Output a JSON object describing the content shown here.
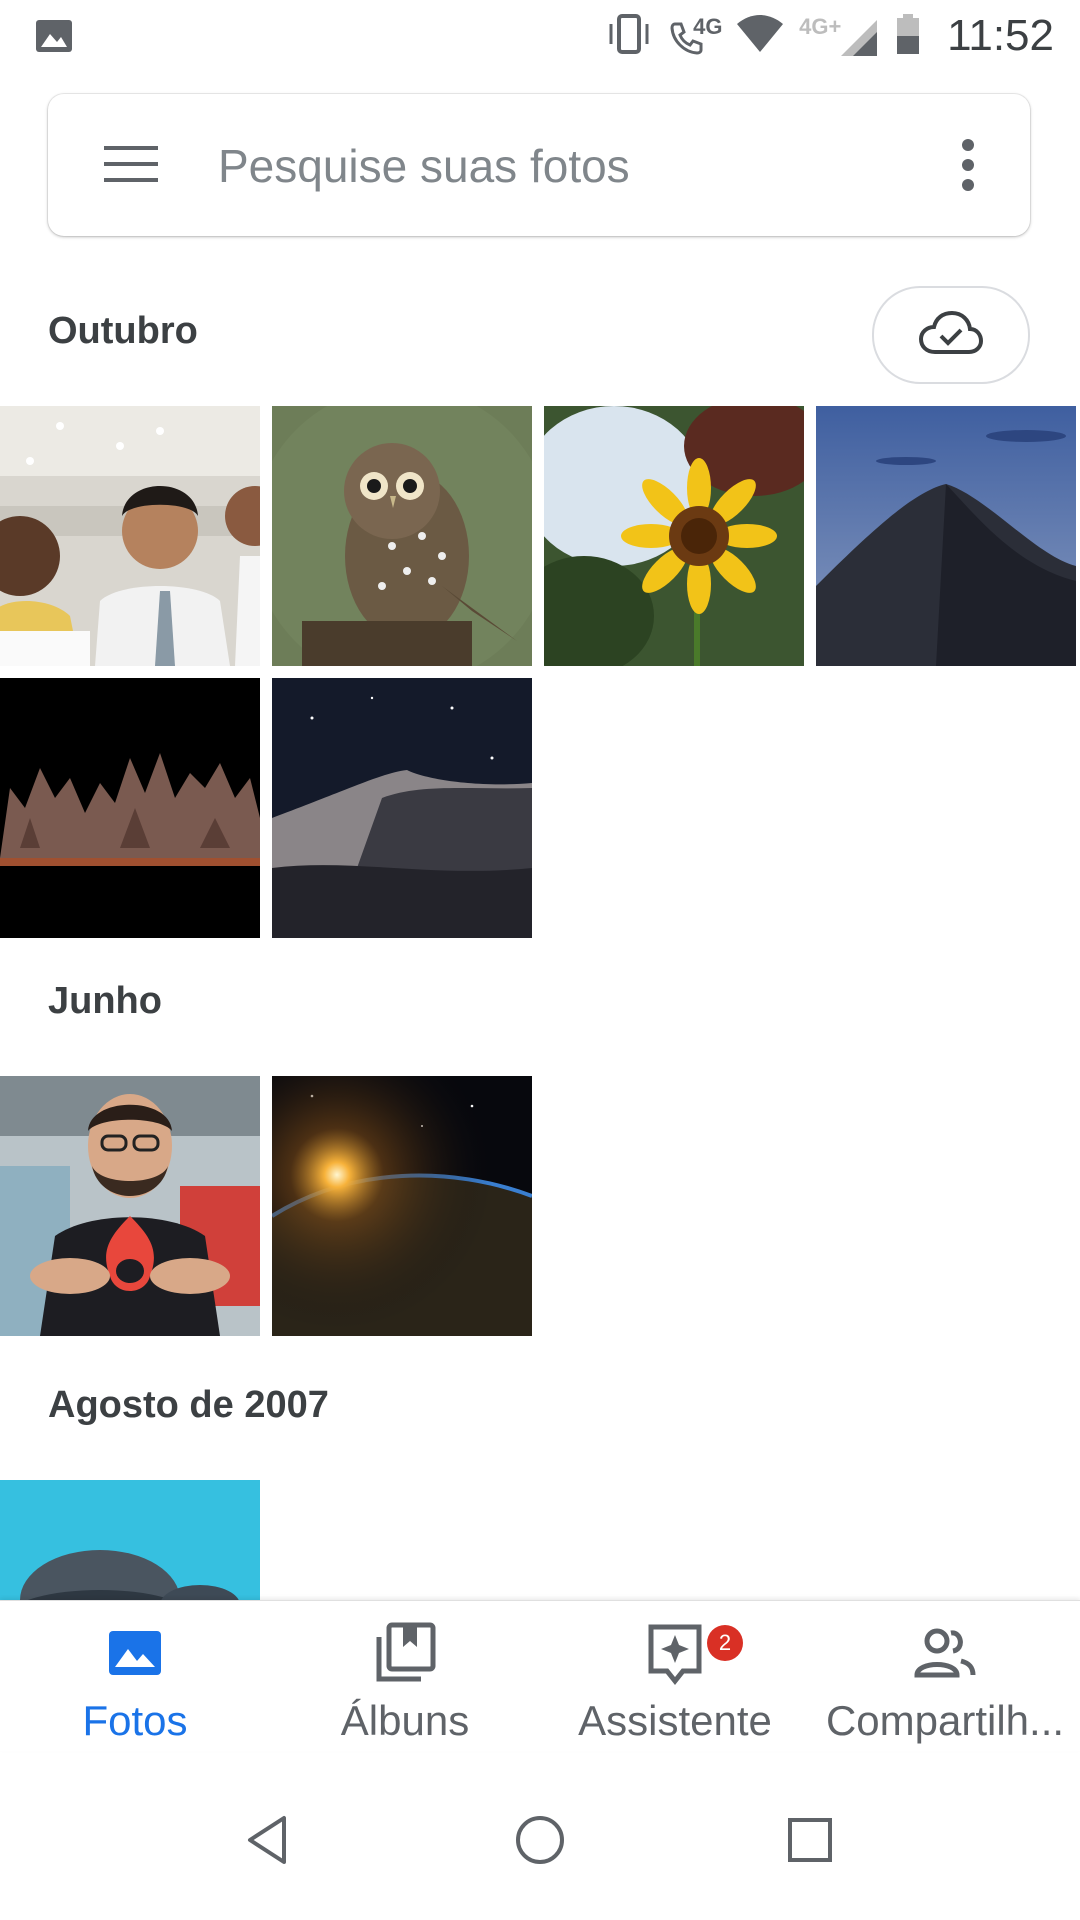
{
  "status_bar": {
    "network_4g": "4G",
    "network_4g_plus": "4G+",
    "time": "11:52"
  },
  "search": {
    "placeholder": "Pesquise suas fotos"
  },
  "sections": [
    {
      "title": "Outubro"
    },
    {
      "title": "Junho"
    },
    {
      "title": "Agosto de 2007"
    }
  ],
  "bottom_nav": {
    "items": [
      {
        "label": "Fotos",
        "icon": "photo-icon",
        "active": true
      },
      {
        "label": "Álbuns",
        "icon": "albums-icon"
      },
      {
        "label": "Assistente",
        "icon": "assistant-icon",
        "badge": "2"
      },
      {
        "label": "Compartilh...",
        "icon": "people-icon"
      }
    ]
  },
  "colors": {
    "accent": "#1a73e8",
    "badge": "#d93025",
    "text": "#3c4043",
    "icon": "#5f6368"
  }
}
